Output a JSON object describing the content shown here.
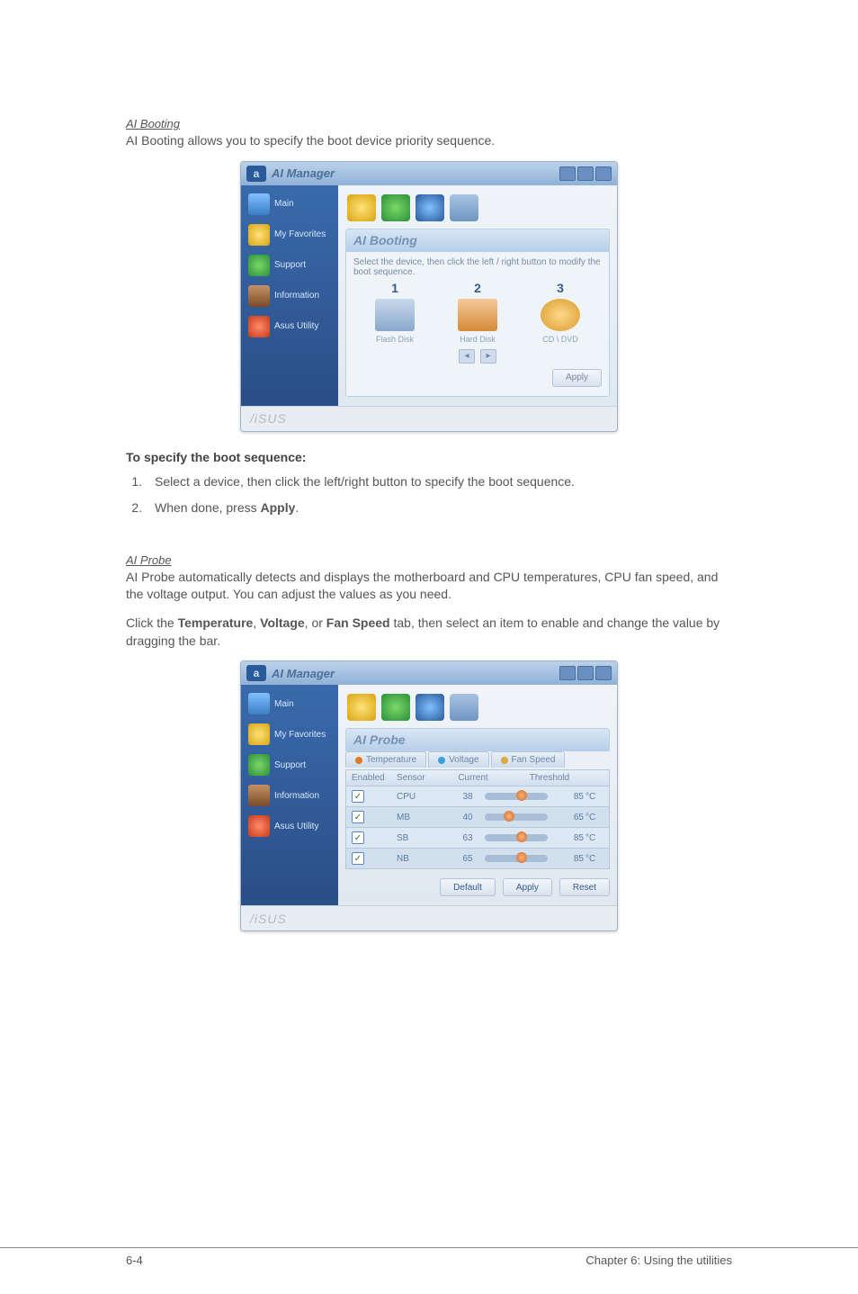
{
  "sections": {
    "booting": {
      "title": "AI Booting",
      "desc": "AI Booting allows you to specify the boot device priority sequence.",
      "window_title": "AI Manager",
      "panel_title": "AI Booting",
      "instruction": "Select the device, then click the left / right button to modify the boot sequence.",
      "cols": [
        "1",
        "2",
        "3"
      ],
      "drives": [
        "Flash Disk",
        "Hard Disk",
        "CD \\ DVD"
      ],
      "apply_label": "Apply",
      "spec_heading": "To specify the boot sequence:",
      "steps": [
        "Select a device, then click the left/right button to specify the boot sequence.",
        "When done, press "
      ],
      "steps_bold": "Apply"
    },
    "probe": {
      "title": "AI Probe",
      "desc": "AI Probe automatically detects and displays the motherboard and CPU temperatures, CPU fan speed, and the voltage output. You can adjust the values as you need.",
      "click_pre": "Click the ",
      "b1": "Temperature",
      "mid1": ", ",
      "b2": "Voltage",
      "mid2": ", or ",
      "b3": "Fan Speed",
      "click_post": " tab, then select an item to enable and change the value by dragging the bar.",
      "window_title": "AI Manager",
      "panel_title": "AI Probe",
      "tabs": [
        "Temperature",
        "Voltage",
        "Fan Speed"
      ],
      "headers": {
        "enabled": "Enabled",
        "sensor": "Sensor",
        "current": "Current",
        "threshold": "Threshold"
      },
      "rows": [
        {
          "sensor": "CPU",
          "current": "38",
          "thr": "85",
          "unit": "°C",
          "pos": 50
        },
        {
          "sensor": "MB",
          "current": "40",
          "thr": "65",
          "unit": "°C",
          "pos": 30
        },
        {
          "sensor": "SB",
          "current": "63",
          "thr": "85",
          "unit": "°C",
          "pos": 50
        },
        {
          "sensor": "NB",
          "current": "65",
          "thr": "85",
          "unit": "°C",
          "pos": 50
        }
      ],
      "buttons": [
        "Default",
        "Apply",
        "Reset"
      ]
    },
    "sidebar": {
      "items": [
        "Main",
        "My Favorites",
        "Support",
        "Information",
        "Asus Utility"
      ],
      "brand": "/iSUS"
    }
  },
  "page_footer": {
    "left": "6-4",
    "right": "Chapter 6: Using the utilities"
  }
}
